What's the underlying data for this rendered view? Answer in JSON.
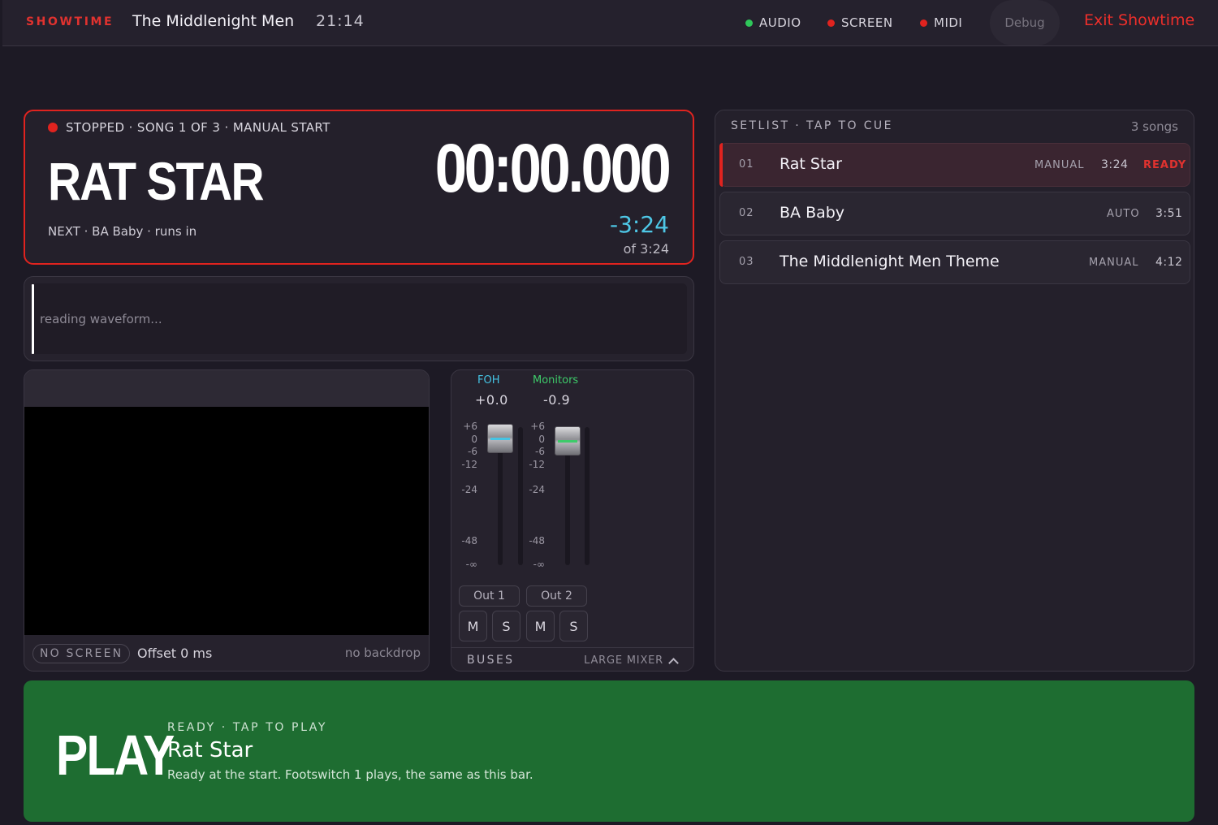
{
  "topbar": {
    "brand": "SHOWTIME",
    "show_name": "The Middlenight Men",
    "clock": "21:14",
    "indicators": [
      {
        "label": "AUDIO",
        "color": "#2fc75a"
      },
      {
        "label": "SCREEN",
        "color": "#e0231f"
      },
      {
        "label": "MIDI",
        "color": "#e0231f"
      }
    ],
    "debug_label": "Debug",
    "exit_label": "Exit Showtime"
  },
  "now": {
    "status": "STOPPED · SONG 1 OF 3 · MANUAL START",
    "status_color": "#e0231f",
    "title": "RAT STAR",
    "timecode": "00:00.000",
    "next": "NEXT · BA Baby · runs in",
    "remaining": "-3:24",
    "of_total": "of 3:24"
  },
  "waveform": {
    "status_text": "reading waveform..."
  },
  "screen": {
    "badge": "NO SCREEN",
    "offset": "Offset 0 ms",
    "backdrop": "no backdrop"
  },
  "mixer": {
    "channels": [
      {
        "name": "FOH",
        "gain": "+0.0",
        "output": "Out 1",
        "mute": "M",
        "solo": "S",
        "color": "#45c4e4"
      },
      {
        "name": "Monitors",
        "gain": "-0.9",
        "output": "Out 2",
        "mute": "M",
        "solo": "S",
        "color": "#3ecb6a"
      }
    ],
    "scale": [
      "+6",
      "0",
      "-6",
      "-12",
      "-24",
      "-48",
      "-∞"
    ],
    "footer_label": "BUSES",
    "toggle_label": "LARGE MIXER"
  },
  "setlist": {
    "header": "SETLIST · TAP TO CUE",
    "count": "3 songs",
    "songs": [
      {
        "num": "01",
        "title": "Rat Star",
        "mode": "MANUAL",
        "duration": "3:24",
        "state": "READY"
      },
      {
        "num": "02",
        "title": "BA Baby",
        "mode": "AUTO",
        "duration": "3:51",
        "state": ""
      },
      {
        "num": "03",
        "title": "The Middlenight Men Theme",
        "mode": "MANUAL",
        "duration": "4:12",
        "state": ""
      }
    ]
  },
  "play": {
    "button_label": "PLAY",
    "state": "READY · TAP TO PLAY",
    "title": "Rat Star",
    "description": "Ready at the start. Footswitch 1 plays, the same as this bar.",
    "color": "#1e6d31"
  }
}
